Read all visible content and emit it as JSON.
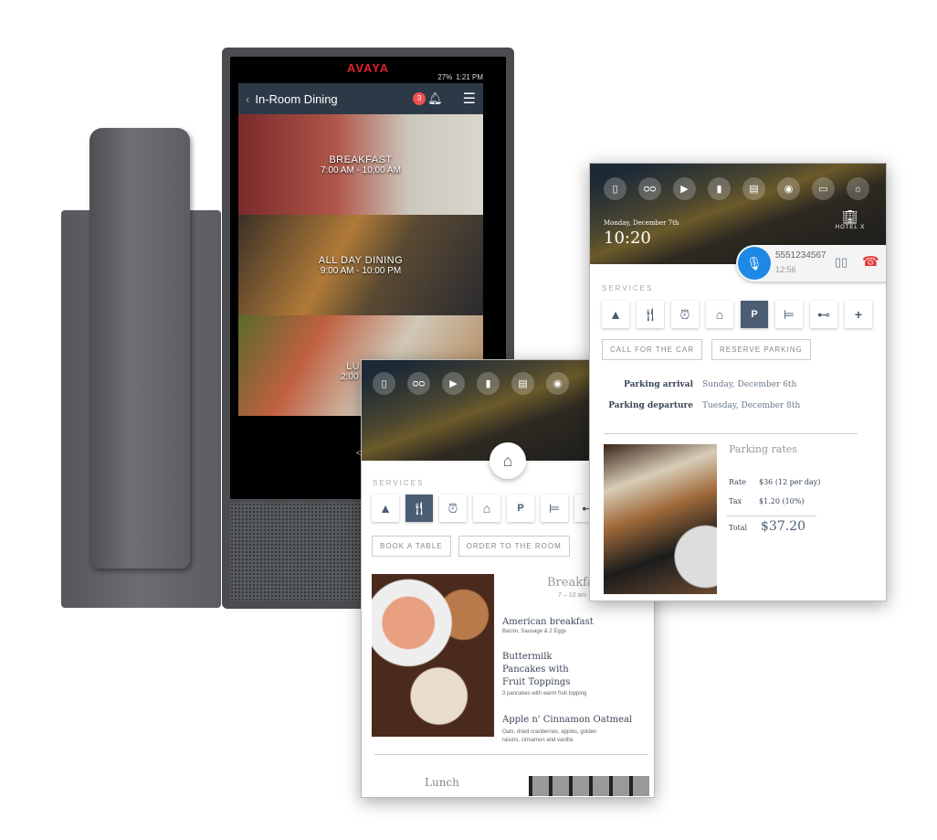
{
  "phone": {
    "brand": "AVAYA",
    "status": {
      "battery": "27%",
      "time": "1:21 PM"
    },
    "header": {
      "title": "In-Room Dining",
      "notification_count": "3"
    },
    "tiles": [
      {
        "name": "BREAKFAST",
        "hours": "7:00 AM - 10:00 AM"
      },
      {
        "name": "ALL DAY DINING",
        "hours": "9:00 AM - 10:00 PM"
      },
      {
        "name": "LU",
        "hours": "2:00 P"
      }
    ]
  },
  "dining_panel": {
    "services_label": "SERVICES",
    "actions": [
      "BOOK A TABLE",
      "ORDER TO THE ROOM"
    ],
    "menu": {
      "title": "Breakfas",
      "hours": "7 – 10 am",
      "items": [
        {
          "name": "American breakfast",
          "desc": "Bacon, Sausage & 2 Eggs"
        },
        {
          "name": "Buttermilk Pancakes with Fruit Toppings",
          "desc": "3 pancakes with warm fruit topping"
        },
        {
          "name": "Apple n' Cinnamon Oatmeal",
          "desc": "Oats, dried cranberries, apples, golden raisins, cinnamon and vanilla"
        }
      ]
    },
    "next_section": "Lunch"
  },
  "parking_panel": {
    "date": "Monday, December 7th",
    "time": "10:20",
    "hotel": "HOTEL X",
    "call": {
      "number": "5551234567",
      "duration": "12:56"
    },
    "services_label": "SERVICES",
    "actions": [
      "CALL FOR THE CAR",
      "RESERVE PARKING"
    ],
    "arrival_label": "Parking arrival",
    "arrival": "Sunday, December 6th",
    "departure_label": "Parking departure",
    "departure": "Tuesday, December 8th",
    "rates": {
      "title": "Parking rates",
      "rate_label": "Rate",
      "rate": "$36 (12 per day)",
      "tax_label": "Tax",
      "tax": "$1.20 (10%)",
      "total_label": "Total",
      "total": "$37.20"
    }
  },
  "colors": {
    "accent": "#4b5d72",
    "call_blue": "#1e88e5",
    "hangup": "#e53935",
    "brand": "#e0202a"
  }
}
